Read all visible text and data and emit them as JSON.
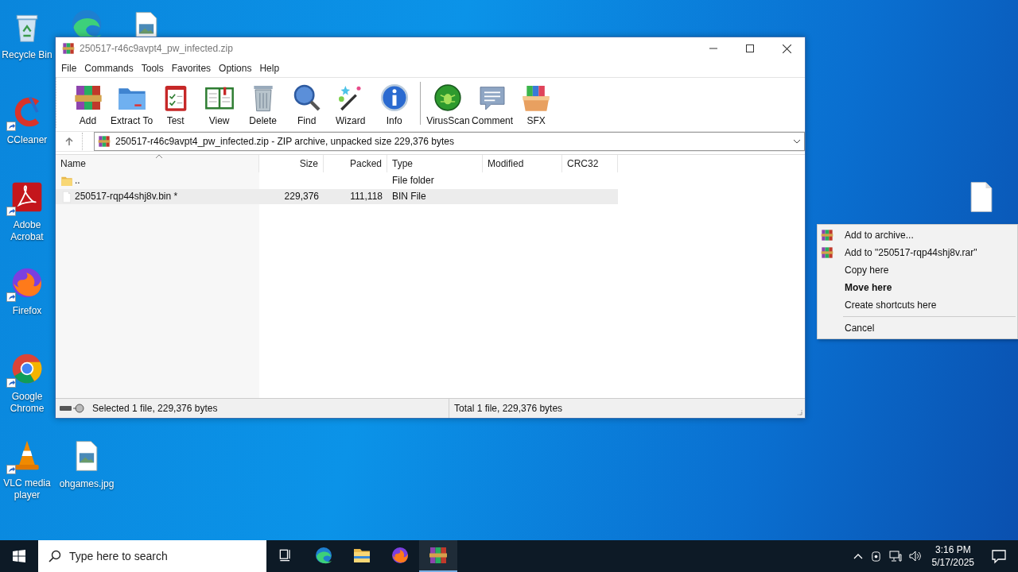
{
  "desktop": {
    "icons": [
      {
        "kind": "recycle",
        "label": "Recycle Bin"
      },
      {
        "kind": "edge"
      },
      {
        "kind": "image"
      },
      {
        "kind": "ccleaner",
        "label": "CCleaner",
        "shortcut": true
      },
      {
        "kind": "acrobat",
        "label": "Adobe Acrobat",
        "shortcut": true
      },
      {
        "kind": "firefox",
        "label": "Firefox",
        "shortcut": true
      },
      {
        "kind": "chrome",
        "label": "Google Chrome",
        "shortcut": true
      },
      {
        "kind": "vlc",
        "label": "VLC media player",
        "shortcut": true
      },
      {
        "kind": "image",
        "label": "ohgames.jpg"
      },
      {
        "kind": "file"
      }
    ]
  },
  "window": {
    "title": "250517-r46c9avpt4_pw_infected.zip",
    "menu": [
      "File",
      "Commands",
      "Tools",
      "Favorites",
      "Options",
      "Help"
    ],
    "toolbar": [
      {
        "kind": "add",
        "label": "Add"
      },
      {
        "kind": "extract",
        "label": "Extract To"
      },
      {
        "kind": "test",
        "label": "Test"
      },
      {
        "kind": "view",
        "label": "View"
      },
      {
        "kind": "delete",
        "label": "Delete"
      },
      {
        "kind": "find",
        "label": "Find"
      },
      {
        "kind": "wizard",
        "label": "Wizard"
      },
      {
        "kind": "info",
        "label": "Info"
      },
      {
        "kind": "separator"
      },
      {
        "kind": "virusscan",
        "label": "VirusScan"
      },
      {
        "kind": "comment",
        "label": "Comment"
      },
      {
        "kind": "sfx",
        "label": "SFX"
      }
    ],
    "address": "250517-r46c9avpt4_pw_infected.zip - ZIP archive, unpacked size 229,376 bytes",
    "columns": [
      {
        "label": "Name",
        "sorted": true
      },
      {
        "label": "Size",
        "sorted": false
      },
      {
        "label": "Packed",
        "sorted": false
      },
      {
        "label": "Type",
        "sorted": false
      },
      {
        "label": "Modified",
        "sorted": false
      },
      {
        "label": "CRC32",
        "sorted": false
      }
    ],
    "rows": [
      {
        "kind": "folder",
        "name": "..",
        "size": "",
        "packed": "",
        "type": "File folder",
        "selected": false
      },
      {
        "kind": "file",
        "name": "250517-rqp44shj8v.bin *",
        "size": "229,376",
        "packed": "111,118",
        "type": "BIN File",
        "selected": true
      }
    ],
    "status_bar": {
      "left": "Selected 1 file, 229,376 bytes",
      "right": "Total 1 file, 229,376 bytes"
    }
  },
  "context_menu": {
    "items": [
      {
        "kind": "item",
        "icon": true,
        "label": "Add to archive...",
        "default": false
      },
      {
        "kind": "item",
        "icon": true,
        "label": "Add to \"250517-rqp44shj8v.rar\"",
        "default": false
      },
      {
        "kind": "item",
        "icon": false,
        "label": "Copy here",
        "default": false
      },
      {
        "kind": "item",
        "icon": false,
        "label": "Move here",
        "default": true
      },
      {
        "kind": "item",
        "icon": false,
        "label": "Create shortcuts here",
        "default": false
      },
      {
        "kind": "separator"
      },
      {
        "kind": "item",
        "icon": false,
        "label": "Cancel",
        "default": false
      }
    ]
  },
  "taskbar": {
    "search": {
      "placeholder": "Type here to search"
    },
    "apps": [
      {
        "kind": "taskview",
        "selected": false
      },
      {
        "kind": "edge",
        "selected": false
      },
      {
        "kind": "explorer",
        "selected": false
      },
      {
        "kind": "firefox",
        "selected": false
      },
      {
        "kind": "winrar",
        "selected": true
      }
    ],
    "time": "3:16 PM",
    "date": "5/17/2025"
  }
}
